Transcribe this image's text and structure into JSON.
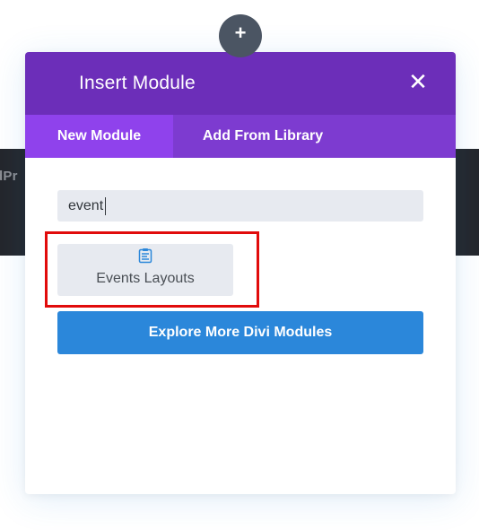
{
  "background": {
    "partial_text": "dPr"
  },
  "add_button": {
    "icon": "plus-icon",
    "glyph": "+"
  },
  "modal": {
    "title": "Insert Module",
    "close_glyph": "✕",
    "tabs": [
      {
        "label": "New Module",
        "active": true
      },
      {
        "label": "Add From Library",
        "active": false
      }
    ],
    "search": {
      "value": "event",
      "placeholder": ""
    },
    "results": [
      {
        "label": "Events Layouts",
        "icon": "layout-document-icon"
      }
    ],
    "explore_label": "Explore More Divi Modules"
  },
  "colors": {
    "header": "#6c2eb9",
    "tabs_bar": "#7d3bd0",
    "active_tab": "#8f42ec",
    "explore_button": "#2b87da",
    "highlight": "#e10b0b",
    "dark_strip": "#24262b"
  }
}
